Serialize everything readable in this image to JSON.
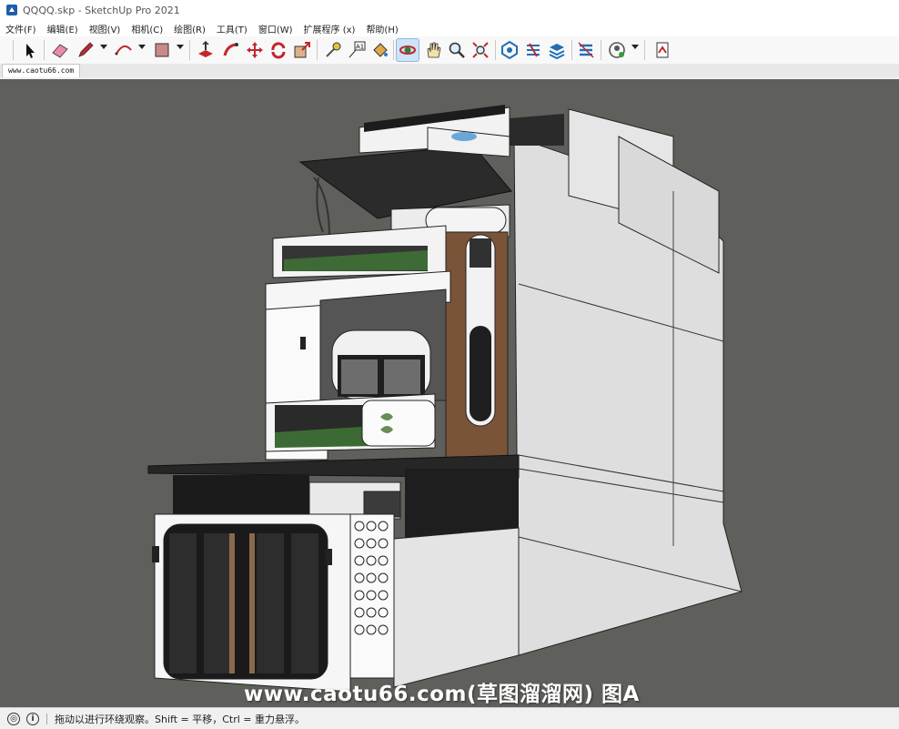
{
  "window": {
    "title": "QQQQ.skp - SketchUp Pro 2021"
  },
  "menu": [
    "文件(F)",
    "编辑(E)",
    "视图(V)",
    "相机(C)",
    "绘图(R)",
    "工具(T)",
    "窗口(W)",
    "扩展程序 (x)",
    "帮助(H)"
  ],
  "toolbar": {
    "tools": [
      "select-tool",
      "eraser-tool",
      "pencil-tool",
      "arc-tool",
      "rectangle-tool",
      "push-pull-tool",
      "follow-me-tool",
      "move-tool",
      "rotate-tool",
      "scale-tool",
      "tape-measure-tool",
      "text-tool",
      "paint-bucket-tool",
      "orbit-tool",
      "pan-tool",
      "zoom-tool",
      "zoom-extents-tool",
      "warehouse-tool",
      "extension-warehouse-tool",
      "layout-tool",
      "send-to-layout-tool",
      "profile-tool",
      "report-tool"
    ],
    "active": "orbit-tool"
  },
  "tabs": {
    "scene": "www.caotu66.com"
  },
  "viewport": {
    "background": "#5f5f5b",
    "watermark": "www.caotu66.com(草图溜溜网) 图A"
  },
  "status": {
    "hint": "拖动以进行环绕观察。Shift = 平移，Ctrl = 重力悬浮。"
  }
}
